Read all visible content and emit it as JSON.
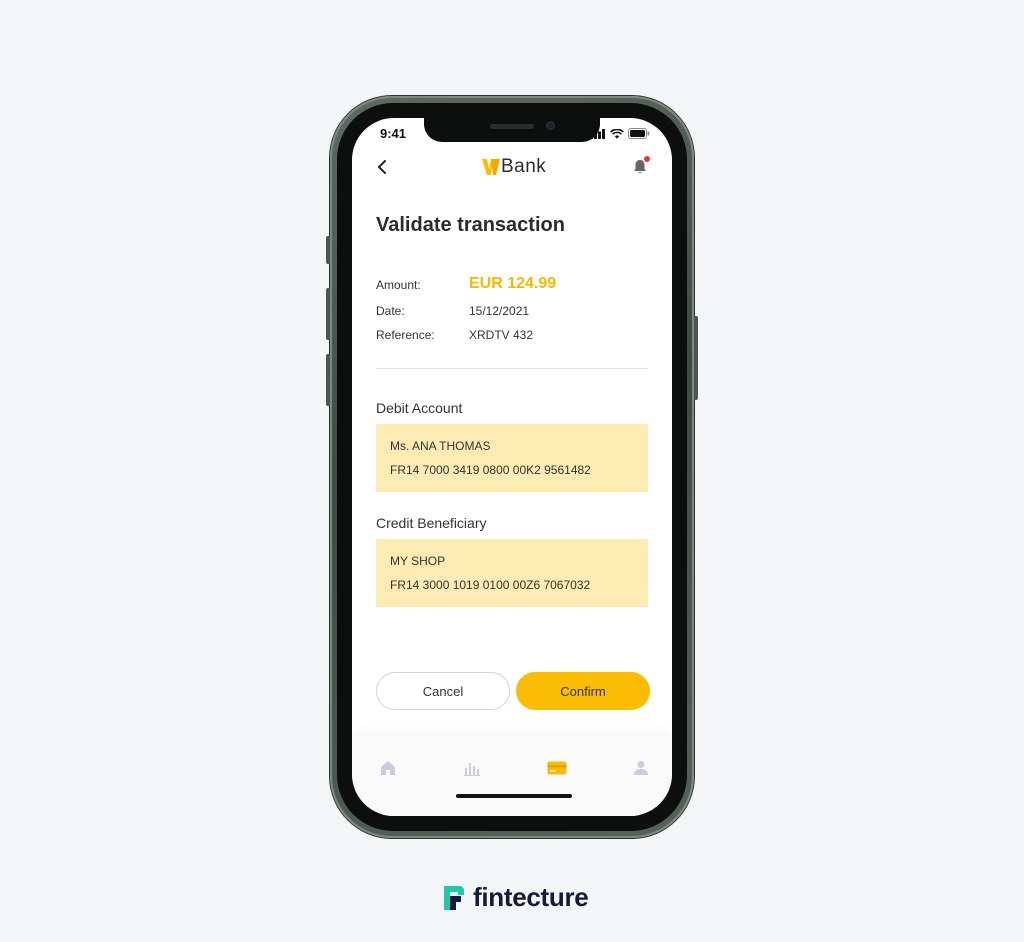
{
  "status_bar": {
    "time": "9:41",
    "icons": [
      "signal-icon",
      "wifi-icon",
      "battery-icon"
    ]
  },
  "header": {
    "logo_text": "Bank",
    "logo_mark": "w-logo-icon",
    "notification_badge": true
  },
  "page": {
    "title": "Validate transaction"
  },
  "details": {
    "amount_label": "Amount:",
    "amount_value": "EUR 124.99",
    "date_label": "Date:",
    "date_value": "15/12/2021",
    "reference_label": "Reference:",
    "reference_value": "XRDTV 432"
  },
  "debit": {
    "title": "Debit Account",
    "name": "Ms. ANA THOMAS",
    "iban": "FR14 7000 3419 0800 00K2 9561482"
  },
  "credit": {
    "title": "Credit Beneficiary",
    "name": "MY SHOP",
    "iban": "FR14 3000 1019 0100 00Z6 7067032"
  },
  "actions": {
    "cancel_label": "Cancel",
    "confirm_label": "Confirm"
  },
  "tab_bar": {
    "tabs": [
      "home-icon",
      "stats-icon",
      "card-icon",
      "profile-icon"
    ],
    "active": "card-icon"
  },
  "footer": {
    "brand_text": "fintecture"
  },
  "colors": {
    "accent": "#fbbc04",
    "amount": "#f5b800",
    "card_bg": "#feeab3",
    "tab_inactive": "#c9cbe0",
    "brand_teal": "#1ec8a8",
    "brand_navy": "#141a3a"
  }
}
